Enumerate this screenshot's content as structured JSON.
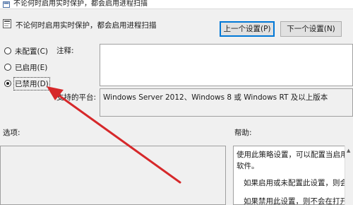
{
  "window": {
    "title": "不论何时启用实时保护，都会启用进程扫描"
  },
  "header": {
    "policy_name": "不论何时启用实时保护，都会启用进程扫描"
  },
  "nav": {
    "prev_label": "上一个设置(P)",
    "next_label": "下一个设置(N)"
  },
  "state_options": [
    {
      "label": "未配置(C)",
      "selected": false
    },
    {
      "label": "已启用(E)",
      "selected": false
    },
    {
      "label": "已禁用(D)",
      "selected": true
    }
  ],
  "comment": {
    "label": "注释:",
    "value": ""
  },
  "supported": {
    "label": "支持的平台:",
    "value": "Windows Server 2012、Windows 8 或 Windows RT 及以上版本"
  },
  "options": {
    "label": "选项:"
  },
  "help": {
    "label": "帮助:",
    "lines": [
      "使用此策略设置，可以配置当启用实时",
      "软件。",
      "如果启用或未配置此设置，则会在启",
      "如果禁用此设置，则不会在打开进程"
    ]
  },
  "colors": {
    "annotation_arrow": "#d6282a",
    "focus_border": "#0078d7",
    "window_bg": "#f0f0f0"
  },
  "icons": {
    "title": "policy-setting-icon",
    "header": "policy-document-icon"
  }
}
